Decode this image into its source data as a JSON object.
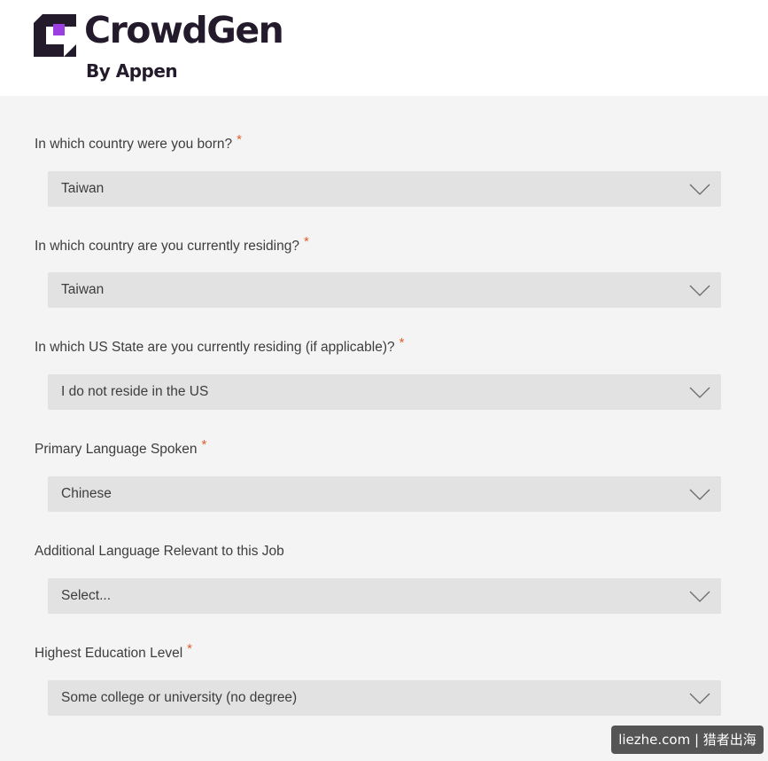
{
  "brand": {
    "name": "CrowdGen",
    "tagline": "By Appen",
    "colors": {
      "dark": "#231a2b",
      "purple": "#9b3fe0",
      "accent": "#e0602e"
    }
  },
  "form": {
    "required_marker": "*",
    "fields": [
      {
        "label": "In which country were you born?",
        "required": true,
        "value": "Taiwan"
      },
      {
        "label": "In which country are you currently residing?",
        "required": true,
        "value": "Taiwan"
      },
      {
        "label": "In which US State are you currently residing (if applicable)?",
        "required": true,
        "value": "I do not reside in the US"
      },
      {
        "label": "Primary Language Spoken",
        "required": true,
        "value": "Chinese"
      },
      {
        "label": "Additional Language Relevant to this Job",
        "required": false,
        "value": "Select..."
      },
      {
        "label": "Highest Education Level",
        "required": true,
        "value": "Some college or university (no degree)"
      }
    ]
  },
  "watermark": "liezhe.com | 猎者出海",
  "icons": {
    "dropdown": "chevron-down-icon",
    "logo": "crowdgen-logo-mark"
  }
}
